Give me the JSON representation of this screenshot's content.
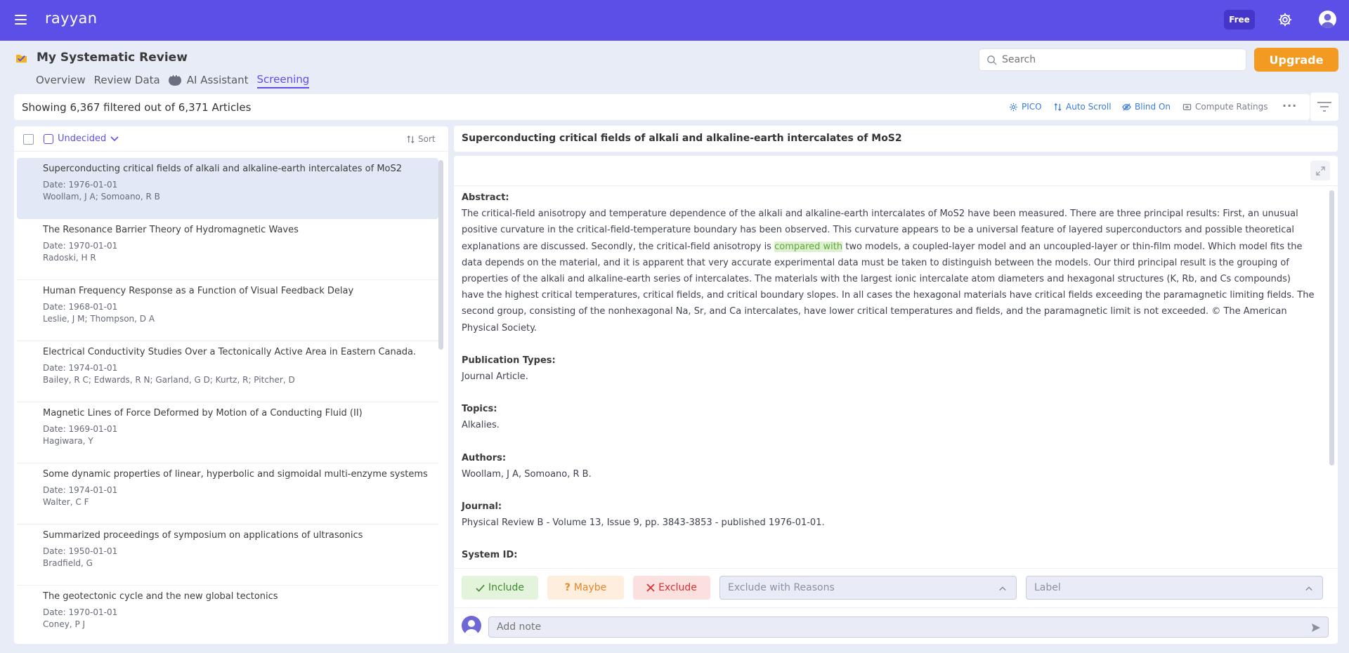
{
  "app": {
    "logo": "rayyan",
    "plan_badge": "Free"
  },
  "header": {
    "review_title": "My Systematic Review",
    "tabs": [
      {
        "label": "Overview",
        "active": false
      },
      {
        "label": "Review Data",
        "active": false
      },
      {
        "label": "AI Assistant",
        "active": false
      },
      {
        "label": "Screening",
        "active": true
      }
    ],
    "search_placeholder": "Search",
    "upgrade_label": "Upgrade"
  },
  "toolbar": {
    "count_text": "Showing 6,367 filtered out of 6,371 Articles",
    "pico": "PICO",
    "auto_scroll": "Auto Scroll",
    "blind_on": "Blind On",
    "compute_ratings": "Compute Ratings"
  },
  "list": {
    "filter_label": "Undecided",
    "sort_label": "Sort",
    "articles": [
      {
        "title": "Superconducting critical fields of alkali and alkaline-earth intercalates of MoS2",
        "date": "Date: 1976-01-01",
        "authors": "Woollam, J A; Somoano, R B",
        "selected": true
      },
      {
        "title": "The Resonance Barrier Theory of Hydromagnetic Waves",
        "date": "Date: 1970-01-01",
        "authors": "Radoski, H R"
      },
      {
        "title": "Human Frequency Response as a Function of Visual Feedback Delay",
        "date": "Date: 1968-01-01",
        "authors": "Leslie, J M; Thompson, D A"
      },
      {
        "title": "Electrical Conductivity Studies Over a Tectonically Active Area in Eastern Canada.",
        "date": "Date: 1974-01-01",
        "authors": "Bailey, R C; Edwards, R N; Garland, G D; Kurtz, R; Pitcher, D"
      },
      {
        "title": "Magnetic Lines of Force Deformed by Motion of a Conducting Fluid (II)",
        "date": "Date: 1969-01-01",
        "authors": "Hagiwara, Y"
      },
      {
        "title": "Some dynamic properties of linear, hyperbolic and sigmoidal multi-enzyme systems",
        "date": "Date: 1974-01-01",
        "authors": "Walter, C F"
      },
      {
        "title": "Summarized proceedings of symposium on applications of ultrasonics",
        "date": "Date: 1950-01-01",
        "authors": "Bradfield, G"
      },
      {
        "title": "The geotectonic cycle and the new global tectonics",
        "date": "Date: 1970-01-01",
        "authors": "Coney, P J"
      }
    ]
  },
  "detail": {
    "title": "Superconducting critical fields of alkali and alkaline-earth intercalates of MoS2",
    "abstract_label": "Abstract:",
    "abstract_before": "The critical-field anisotropy and temperature dependence of the alkali and alkaline-earth intercalates of MoS2 have been measured. There are three principal results: First, an unusual positive curvature in the critical-field-temperature boundary has been observed. This curvature appears to be a universal feature of layered superconductors and possible theoretical explanations are discussed. Secondly, the critical-field anisotropy is ",
    "abstract_highlight": "compared with",
    "abstract_after": " two models, a coupled-layer model and an uncoupled-layer or thin-film model. Which model fits the data depends on the material, and it is apparent that very accurate experimental data must be taken to distinguish between the models. Our third principal result is the grouping of properties of the alkali and alkaline-earth series of intercalates. The materials with the largest ionic intercalate atom diameters and hexagonal structures (K, Rb, and Cs compounds) have the highest critical temperatures, critical fields, and critical boundary slopes. In all cases the hexagonal materials have critical fields exceeding the paramagnetic limiting fields. The second group, consisting of the nonhexagonal Na, Sr, and Ca intercalates, have lower critical temperatures and fields, and the paramagnetic limit is not exceeded. © The American Physical Society.",
    "pub_types_label": "Publication Types:",
    "pub_types": "Journal Article.",
    "topics_label": "Topics:",
    "topics": "Alkalies.",
    "authors_label": "Authors:",
    "authors": "Woollam, J A, Somoano, R B.",
    "journal_label": "Journal:",
    "journal": "Physical Review B - Volume 13, Issue 9, pp. 3843-3853 - published 1976-01-01.",
    "system_id_label": "System ID:"
  },
  "decision": {
    "include": "Include",
    "maybe": "Maybe",
    "exclude": "Exclude",
    "exclude_reasons_placeholder": "Exclude with Reasons",
    "label_placeholder": "Label",
    "note_placeholder": "Add note"
  },
  "colors": {
    "brand": "#5b4fe8",
    "upgrade": "#f39a22",
    "link_blue": "#3a7bd5",
    "include_green": "#3e8a2c",
    "maybe_orange": "#e6862a",
    "exclude_red": "#d93030"
  },
  "icons": [
    "menu-icon",
    "gear-icon",
    "user-avatar-icon",
    "review-folder-icon",
    "ai-chat-icon",
    "search-icon",
    "pico-icon",
    "auto-scroll-icon",
    "blind-icon",
    "compute-ratings-icon",
    "more-icon",
    "filter-icon",
    "undecided-icon",
    "chevron-down-icon",
    "sort-icon",
    "expand-icon",
    "check-icon",
    "question-icon",
    "x-icon",
    "chevron-up-icon",
    "send-icon"
  ]
}
